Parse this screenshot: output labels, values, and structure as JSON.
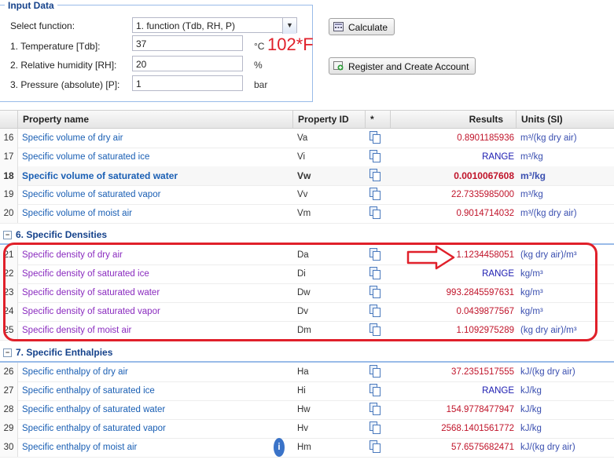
{
  "input": {
    "title": "Input Data",
    "select_label": "Select function:",
    "select_value": "1. function (Tdb, RH, P)",
    "fields": [
      {
        "label": "1. Temperature [Tdb]:",
        "value": "37",
        "unit": "°C"
      },
      {
        "label": "2. Relative humidity [RH]:",
        "value": "20",
        "unit": "%"
      },
      {
        "label": "3. Pressure (absolute) [P]:",
        "value": "1",
        "unit": "bar"
      }
    ],
    "annotation": "102*F",
    "calculate_label": "Calculate",
    "register_label": "Register and Create Account"
  },
  "table": {
    "headers": {
      "name": "Property name",
      "id": "Property ID",
      "star": "*",
      "results": "Results",
      "units": "Units (SI)"
    },
    "rows_top": [
      {
        "num": "16",
        "name": "Specific volume of dry air",
        "id": "Va",
        "result": "0.8901185936",
        "unit": "m³/(kg dry air)"
      },
      {
        "num": "17",
        "name": "Specific volume of saturated ice",
        "id": "Vi",
        "result": "RANGE",
        "unit": "m³/kg"
      },
      {
        "num": "18",
        "name": "Specific volume of saturated water",
        "id": "Vw",
        "result": "0.0010067608",
        "unit": "m³/kg"
      },
      {
        "num": "19",
        "name": "Specific volume of saturated vapor",
        "id": "Vv",
        "result": "22.7335985000",
        "unit": "m³/kg"
      },
      {
        "num": "20",
        "name": "Specific volume of moist air",
        "id": "Vm",
        "result": "0.9014714032",
        "unit": "m³/(kg dry air)"
      }
    ],
    "group6": "6. Specific Densities",
    "rows_dens": [
      {
        "num": "21",
        "name": "Specific density of dry air",
        "id": "Da",
        "result": "1.1234458051",
        "unit": "(kg dry air)/m³"
      },
      {
        "num": "22",
        "name": "Specific density of saturated ice",
        "id": "Di",
        "result": "RANGE",
        "unit": "kg/m³"
      },
      {
        "num": "23",
        "name": "Specific density of saturated water",
        "id": "Dw",
        "result": "993.2845597631",
        "unit": "kg/m³"
      },
      {
        "num": "24",
        "name": "Specific density of saturated vapor",
        "id": "Dv",
        "result": "0.0439877567",
        "unit": "kg/m³"
      },
      {
        "num": "25",
        "name": "Specific density of moist air",
        "id": "Dm",
        "result": "1.1092975289",
        "unit": "(kg dry air)/m³"
      }
    ],
    "group7": "7. Specific Enthalpies",
    "rows_enth": [
      {
        "num": "26",
        "name": "Specific enthalpy of dry air",
        "id": "Ha",
        "result": "37.2351517555",
        "unit": "kJ/(kg dry air)"
      },
      {
        "num": "27",
        "name": "Specific enthalpy of saturated ice",
        "id": "Hi",
        "result": "RANGE",
        "unit": "kJ/kg"
      },
      {
        "num": "28",
        "name": "Specific enthalpy of saturated water",
        "id": "Hw",
        "result": "154.9778477947",
        "unit": "kJ/kg"
      },
      {
        "num": "29",
        "name": "Specific enthalpy of saturated vapor",
        "id": "Hv",
        "result": "2568.1401561772",
        "unit": "kJ/kg"
      },
      {
        "num": "30",
        "name": "Specific enthalpy of moist air",
        "id": "Hm",
        "result": "57.6575682471",
        "unit": "kJ/(kg dry air)"
      }
    ],
    "info_glyph": "i"
  }
}
